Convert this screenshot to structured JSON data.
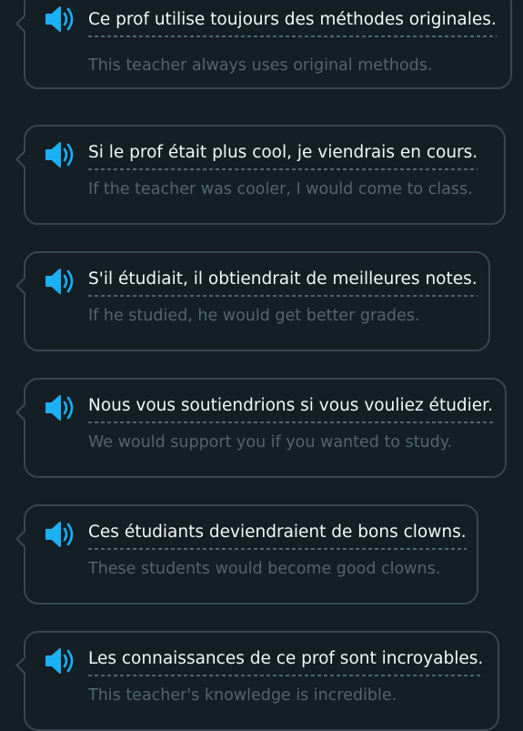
{
  "colors": {
    "background": "#131f24",
    "card_border": "#37464f",
    "speaker": "#1cb0f6",
    "french_text": "#f1f7fb",
    "english_text": "#52656d"
  },
  "cards": [
    {
      "icon": "speaker-icon",
      "french": "Ce prof utilise toujours des méthodes originales.",
      "english": "This teacher always uses original methods."
    },
    {
      "icon": "speaker-icon",
      "french": "Si le prof était plus cool, je viendrais en cours.",
      "english": "If the teacher was cooler, I would come to class."
    },
    {
      "icon": "speaker-icon",
      "french": "S'il étudiait, il obtiendrait de meilleures notes.",
      "english": "If he studied, he would get better grades."
    },
    {
      "icon": "speaker-icon",
      "french": "Nous vous soutiendrions si vous vouliez étudier.",
      "english": "We would support you if you wanted to study."
    },
    {
      "icon": "speaker-icon",
      "french": "Ces étudiants deviendraient de bons clowns.",
      "english": "These students would become good clowns."
    },
    {
      "icon": "speaker-icon",
      "french": "Les connaissances de ce prof sont incroyables.",
      "english": "This teacher's knowledge is incredible."
    }
  ]
}
